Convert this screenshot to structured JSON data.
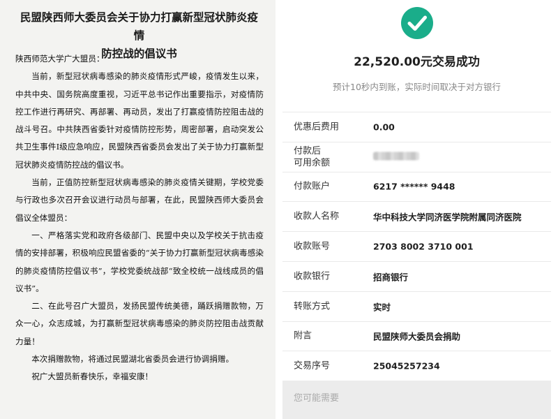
{
  "letter": {
    "title_line1": "民盟陕西师大委员会关于协力打赢新型冠状肺炎疫情",
    "title_line2": "防控战的倡议书",
    "salutation": "陕西师范大学广大盟员：",
    "paragraphs": [
      "当前，新型冠状病毒感染的肺炎疫情形式严峻，疫情发生以来，中共中央、国务院高度重视，习近平总书记作出重要指示，对疫情防控工作进行再研究、再部署、再动员，发出了打赢疫情防控阻击战的战斗号召。中共陕西省委针对疫情防控形势，周密部署，启动突发公共卫生事件Ⅰ级应急响应，民盟陕西省委员会发出了关于协力打赢新型冠状肺炎疫情防控战的倡议书。",
      "当前，正值防控新型冠状病毒感染的肺炎疫情关键期，学校党委与行政也多次召开会议进行动员与部署，在此，民盟陕西师大委员会倡议全体盟员：",
      "一、严格落实党和政府各级部门、民盟中央以及学校关于抗击疫情的安排部署，积极响应民盟省委的“关于协力打赢新型冠状病毒感染的肺炎疫情防控倡议书”，学校党委统战部“致全校统一战线成员的倡议书”。",
      "二、在此号召广大盟员，发扬民盟传统美德，踊跃捐赠款物，万众一心，众志成城，为打赢新型冠状病毒感染的肺炎防控阻击战贡献力量！",
      "本次捐赠款物，将通过民盟湖北省委员会进行协调捐赠。",
      "祝广大盟员新春快乐，幸福安康！"
    ]
  },
  "receipt": {
    "success_icon": "check-circle-icon",
    "accent_color": "#1aad8a",
    "amount_text": "22,520.00元交易成功",
    "hint_text": "预计10秒内到账，实际时间取决于对方银行",
    "rows": [
      {
        "label": "优惠后费用",
        "value": "0.00"
      },
      {
        "label": "付款后\n可用余额",
        "value": ""
      },
      {
        "label": "付款账户",
        "value": "6217 ****** 9448"
      },
      {
        "label": "收款人名称",
        "value": "华中科技大学同济医学院附属同济医院"
      },
      {
        "label": "收款账号",
        "value": "2703 8002 3710 001"
      },
      {
        "label": "收款银行",
        "value": "招商银行"
      },
      {
        "label": "转账方式",
        "value": "实时"
      },
      {
        "label": "附言",
        "value": "民盟陕师大委员会捐助"
      },
      {
        "label": "交易序号",
        "value": "25045257234"
      }
    ],
    "footer_text": "您可能需要"
  }
}
